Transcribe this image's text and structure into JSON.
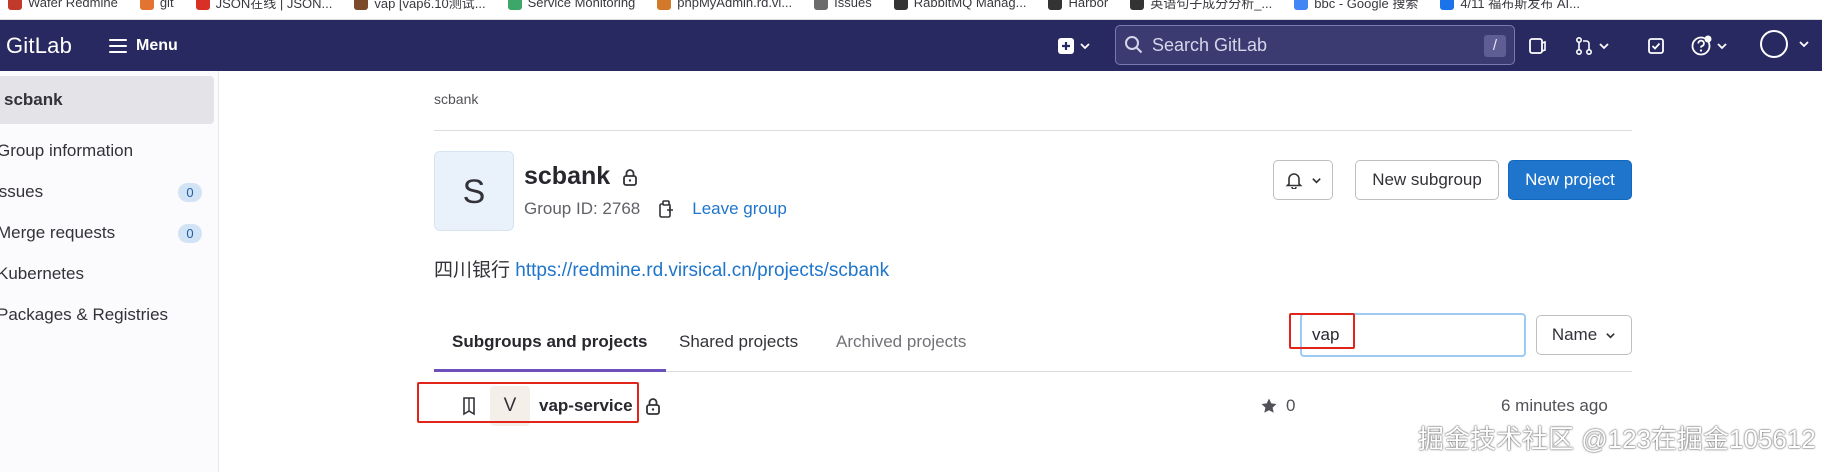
{
  "bookmarks": [
    {
      "label": "Wafer Redmine",
      "icon": "redmine-icon",
      "color": "#c0392b"
    },
    {
      "label": "git",
      "icon": "git-icon",
      "color": "#e37331"
    },
    {
      "label": "JSON在线 | JSON...",
      "icon": "json-icon",
      "color": "#d93025"
    },
    {
      "label": "vap [vap6.10测试...",
      "icon": "vap-icon",
      "color": "#7a4a2a"
    },
    {
      "label": "Service Monitoring",
      "icon": "monitoring-icon",
      "color": "#3fa66a"
    },
    {
      "label": "phpMyAdmin.rd.vi...",
      "icon": "phpmyadmin-icon",
      "color": "#d27a2a"
    },
    {
      "label": "Issues",
      "icon": "issues-icon",
      "color": "#6b6b6b"
    },
    {
      "label": "RabbitMQ Manag...",
      "icon": "rabbitmq-icon",
      "color": "#333333"
    },
    {
      "label": "Harbor",
      "icon": "harbor-icon",
      "color": "#333333"
    },
    {
      "label": "英语句子成分分析_...",
      "icon": "english-icon",
      "color": "#333333"
    },
    {
      "label": "bbc - Google 搜索",
      "icon": "google-icon",
      "color": "#4285f4"
    },
    {
      "label": "4/11 福布斯发布 AI...",
      "icon": "news-icon",
      "color": "#1a73e8"
    }
  ],
  "header": {
    "logo": "GitLab",
    "menu_label": "Menu",
    "search_placeholder": "Search GitLab",
    "search_shortcut": "/"
  },
  "sidebar": {
    "group_title": "scbank",
    "items": [
      {
        "label": "Group information"
      },
      {
        "label": "Issues",
        "badge": "0"
      },
      {
        "label": "Merge requests",
        "badge": "0"
      },
      {
        "label": "Kubernetes"
      },
      {
        "label": "Packages & Registries"
      }
    ]
  },
  "breadcrumb": "scbank",
  "group": {
    "avatar_letter": "S",
    "name": "scbank",
    "group_id": "Group ID: 2768",
    "leave_label": "Leave group",
    "description_prefix": "四川银行",
    "description_link": "https://redmine.rd.virsical.cn/projects/scbank"
  },
  "actions": {
    "new_subgroup": "New subgroup",
    "new_project": "New project"
  },
  "tabs": [
    {
      "label": "Subgroups and projects",
      "active": true
    },
    {
      "label": "Shared projects",
      "active": false
    },
    {
      "label": "Archived projects",
      "active": false
    }
  ],
  "filter": {
    "value": "vap",
    "sort_label": "Name"
  },
  "projects": [
    {
      "avatar_letter": "V",
      "name": "vap-service",
      "stars": "0",
      "updated": "6 minutes ago"
    }
  ],
  "watermark": "掘金技术社区 @123在掘金105612",
  "colors": {
    "topbar": "#292961",
    "primary": "#1f75cb",
    "highlight": "#e1251b",
    "tab_active": "#6b4fbb"
  }
}
